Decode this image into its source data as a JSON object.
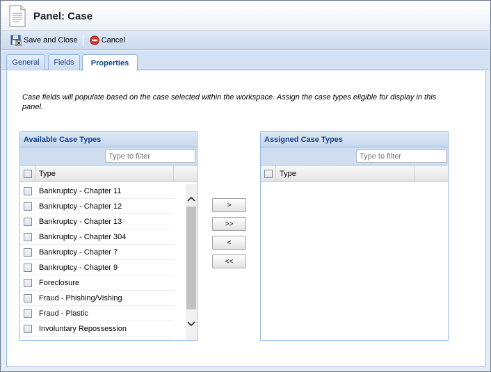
{
  "header": {
    "title": "Panel: Case",
    "icon": "document-icon"
  },
  "toolbar": {
    "save_close_label": "Save and Close",
    "cancel_label": "Cancel"
  },
  "tabs": [
    {
      "label": "General",
      "active": false
    },
    {
      "label": "Fields",
      "active": false
    },
    {
      "label": "Properties",
      "active": true
    }
  ],
  "description": "Case fields will populate based on the case selected within the workspace. Assign the case types eligible for display in this panel.",
  "available": {
    "title": "Available Case Types",
    "filter_placeholder": "Type to filter",
    "column_type": "Type",
    "rows": [
      "Bankruptcy - Chapter 11",
      "Bankruptcy - Chapter 12",
      "Bankruptcy - Chapter 13",
      "Bankruptcy - Chapter 304",
      "Bankruptcy - Chapter 7",
      "Bankruptcy - Chapter 9",
      "Foreclosure",
      "Fraud - Phishing/Vishing",
      "Fraud - Plastic",
      "Involuntary Repossession"
    ]
  },
  "assigned": {
    "title": "Assigned Case Types",
    "filter_placeholder": "Type to filter",
    "column_type": "Type",
    "rows": []
  },
  "move_buttons": {
    "add_one": ">",
    "add_all": ">>",
    "remove_one": "<",
    "remove_all": "<<"
  },
  "colors": {
    "accent_text": "#15428b",
    "border": "#99bbe8",
    "cancel_red": "#d9342b"
  }
}
